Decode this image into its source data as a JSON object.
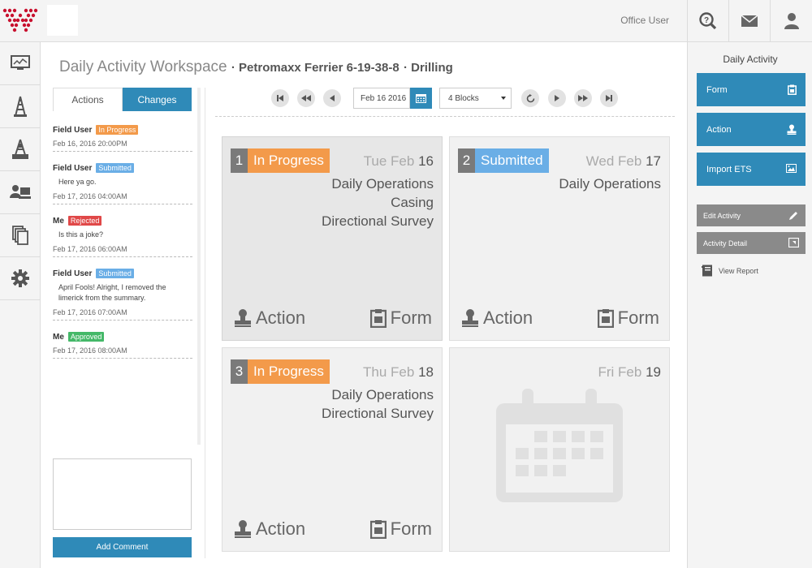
{
  "header": {
    "user_label": "Office User",
    "icons": [
      "help-search-icon",
      "mail-icon",
      "user-icon"
    ],
    "accent": "#2f8ab8",
    "logo_color": "#c8102e"
  },
  "nav": {
    "items": [
      "dashboard-monitor-icon",
      "oil-rig-icon",
      "drilling-rig-icon",
      "user-computer-icon",
      "documents-icon",
      "settings-gear-icon"
    ]
  },
  "page": {
    "title": "Daily Activity Workspace",
    "well": "· Petromaxx Ferrier 6-19-38-8",
    "phase": "· Drilling"
  },
  "tabs": {
    "actions": "Actions",
    "changes": "Changes"
  },
  "feed": [
    {
      "user": "Field User",
      "status": "In Progress",
      "message": "",
      "time": "Feb 16, 2016 20:00PM"
    },
    {
      "user": "Field User",
      "status": "Submitted",
      "message": "Here ya go.",
      "time": "Feb 17, 2016 04:00AM"
    },
    {
      "user": "Me",
      "status": "Rejected",
      "message": "Is this a joke?",
      "time": "Feb 17, 2016 06:00AM"
    },
    {
      "user": "Field User",
      "status": "Submitted",
      "message": "April Fools! Alright, I removed the limerick from the summary.",
      "time": "Feb 17, 2016 07:00AM"
    },
    {
      "user": "Me",
      "status": "Approved",
      "message": "",
      "time": "Feb 17, 2016 08:00AM"
    }
  ],
  "comment": {
    "value": "",
    "button": "Add Comment"
  },
  "toolbar": {
    "date": "Feb 16 2016",
    "blocks": "4 Blocks"
  },
  "blocks": [
    {
      "num": "1",
      "status": "In Progress",
      "day": "Tue Feb",
      "date": "16",
      "lines": [
        "Daily Operations",
        "Casing",
        "Directional Survey"
      ],
      "action": "Action",
      "form": "Form"
    },
    {
      "num": "2",
      "status": "Submitted",
      "day": "Wed Feb",
      "date": "17",
      "lines": [
        "Daily Operations"
      ],
      "action": "Action",
      "form": "Form"
    },
    {
      "num": "3",
      "status": "In Progress",
      "day": "Thu Feb",
      "date": "18",
      "lines": [
        "Daily Operations",
        "Directional Survey"
      ],
      "action": "Action",
      "form": "Form"
    },
    {
      "day": "Fri Feb",
      "date": "19"
    }
  ],
  "right": {
    "title": "Daily Activity",
    "form": "Form",
    "action": "Action",
    "import": "Import ETS",
    "edit": "Edit Activity",
    "detail": "Activity Detail",
    "report": "View Report"
  }
}
